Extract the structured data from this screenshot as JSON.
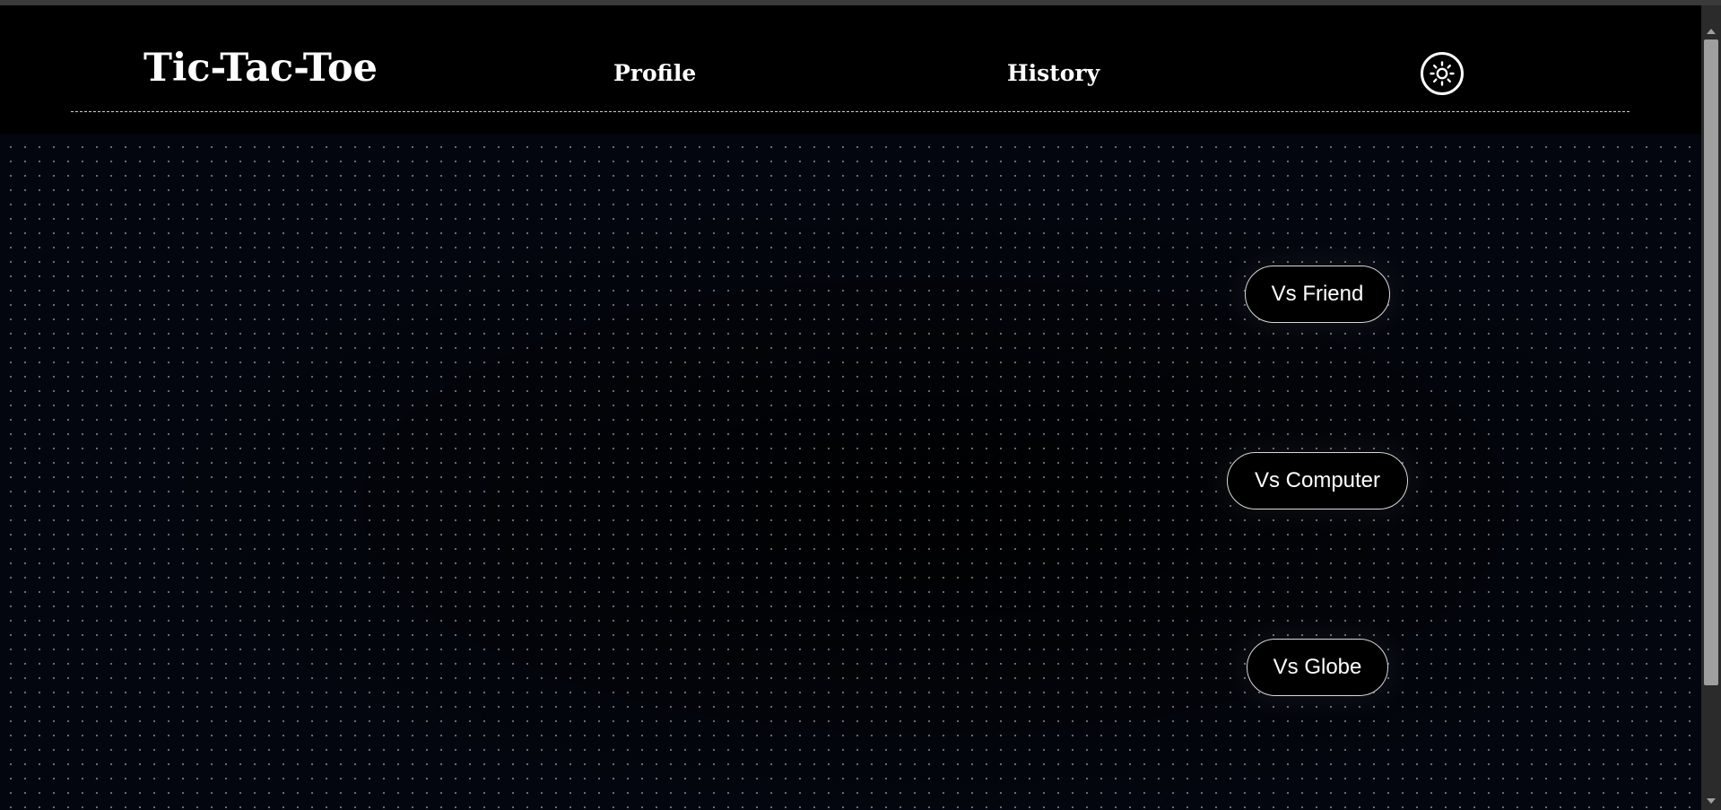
{
  "header": {
    "title": "Tic-Tac-Toe",
    "nav": {
      "profile": "Profile",
      "history": "History"
    },
    "theme_toggle_icon": "sun-icon"
  },
  "main": {
    "modes": {
      "friend": "Vs Friend",
      "computer": "Vs Computer",
      "globe": "Vs Globe"
    }
  },
  "colors": {
    "background": "#000000",
    "main_background": "#03060e",
    "text": "#ffffff",
    "button_border": "#d8d8d8"
  }
}
